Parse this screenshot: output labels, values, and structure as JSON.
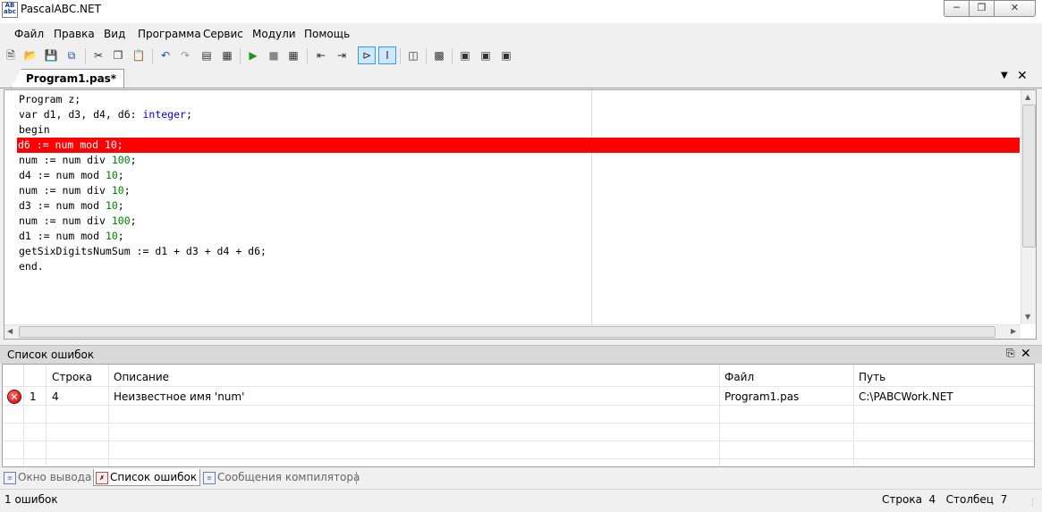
{
  "window": {
    "title": "PascalABC.NET",
    "icon_text": "AB abc"
  },
  "menu": [
    "Файл",
    "Правка",
    "Вид",
    "Программа",
    "Сервис",
    "Модули",
    "Помощь"
  ],
  "tabs": {
    "file_tab": "Program1.pas*"
  },
  "editor": {
    "lines": [
      {
        "text": "Program z;",
        "error": false
      },
      {
        "text": "var d1, d3, d4, d6: integer;",
        "error": false
      },
      {
        "text": "begin",
        "error": false
      },
      {
        "text": "d6 := num mod 10;",
        "error": true
      },
      {
        "text": "num := num div 100;",
        "error": false
      },
      {
        "text": "d4 := num mod 10;",
        "error": false
      },
      {
        "text": "num := num div 10;",
        "error": false
      },
      {
        "text": "d3 := num mod 10;",
        "error": false
      },
      {
        "text": "num := num div 100;",
        "error": false
      },
      {
        "text": "d1 := num mod 10;",
        "error": false
      },
      {
        "text": "getSixDigitsNumSum := d1 + d3 + d4 + d6;",
        "error": false
      },
      {
        "text": "end.",
        "error": false
      }
    ]
  },
  "error_panel": {
    "title": "Список ошибок",
    "columns": [
      "",
      "",
      "Строка",
      "Описание",
      "Файл",
      "Путь"
    ],
    "rows": [
      {
        "num": "1",
        "line": "4",
        "description": "Неизвестное имя 'num'",
        "file": "Program1.pas",
        "path": "C:\\PABCWork.NET"
      }
    ]
  },
  "bottom_tabs": [
    "Окно вывода",
    "Список ошибок",
    "Сообщения компилятора"
  ],
  "status": {
    "left": "1 ошибок",
    "right": "Строка  4   Столбец  7"
  },
  "colors": {
    "error_line": "#ff0000",
    "type_keyword": "#0000ff",
    "number": "#008000"
  }
}
